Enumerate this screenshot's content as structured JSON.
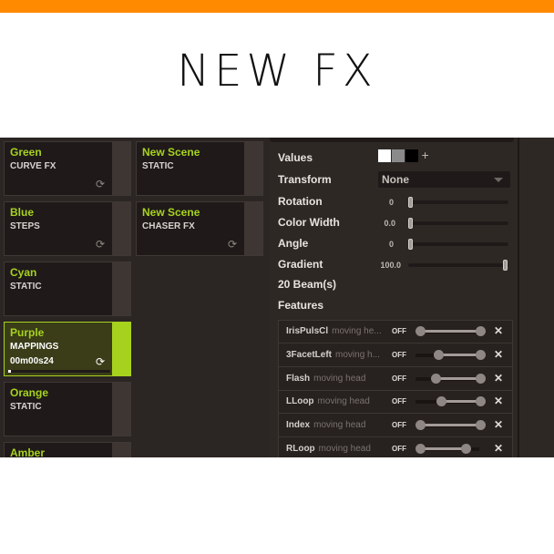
{
  "banner": {
    "title": "NEW FX",
    "accent_color": "#ff8a00"
  },
  "scenes": {
    "column1": [
      {
        "name": "Green",
        "type": "CURVE FX",
        "loop": true,
        "active": false
      },
      {
        "name": "Blue",
        "type": "STEPS",
        "loop": true,
        "active": false
      },
      {
        "name": "Cyan",
        "type": "STATIC",
        "loop": false,
        "active": false
      },
      {
        "name": "Purple",
        "type": "MAPPINGS",
        "time": "00m00s24",
        "loop": true,
        "active": true,
        "progress": 0.03
      },
      {
        "name": "Orange",
        "type": "STATIC",
        "loop": false,
        "active": false
      },
      {
        "name": "Amber",
        "type": "",
        "loop": false,
        "active": false
      }
    ],
    "column2": [
      {
        "name": "New Scene",
        "type": "STATIC",
        "loop": false,
        "active": false
      },
      {
        "name": "New Scene",
        "type": "CHASER FX",
        "loop": true,
        "active": false
      }
    ],
    "accent_color": "#a6d21e"
  },
  "properties": {
    "values": {
      "label": "Values",
      "swatches": [
        "#ffffff",
        "#8a8a8a",
        "#000000"
      ],
      "add_label": "+"
    },
    "transform": {
      "label": "Transform",
      "value": "None"
    },
    "rotation": {
      "label": "Rotation",
      "value": "0",
      "fraction": 0.0
    },
    "color_width": {
      "label": "Color Width",
      "value": "0.0",
      "fraction": 0.0
    },
    "angle": {
      "label": "Angle",
      "value": "0",
      "fraction": 0.0
    },
    "gradient": {
      "label": "Gradient",
      "value": "100.0",
      "fraction": 1.0
    },
    "beams": "20 Beam(s)",
    "features_label": "Features"
  },
  "features": [
    {
      "name": "IrisPulsCl",
      "type": "moving he...",
      "state": "OFF",
      "range": [
        0.0,
        1.0
      ]
    },
    {
      "name": "3FacetLeft",
      "type": "moving h...",
      "state": "OFF",
      "range": [
        0.3,
        1.0
      ]
    },
    {
      "name": "Flash",
      "type": "moving head",
      "state": "OFF",
      "range": [
        0.25,
        1.0
      ]
    },
    {
      "name": "LLoop",
      "type": "moving head",
      "state": "OFF",
      "range": [
        0.35,
        1.0
      ]
    },
    {
      "name": "Index",
      "type": "moving head",
      "state": "OFF",
      "range": [
        0.0,
        1.0
      ]
    },
    {
      "name": "RLoop",
      "type": "moving head",
      "state": "OFF",
      "range": [
        0.0,
        0.75
      ]
    }
  ],
  "remove_label": "✕",
  "loop_icon": "⟳"
}
